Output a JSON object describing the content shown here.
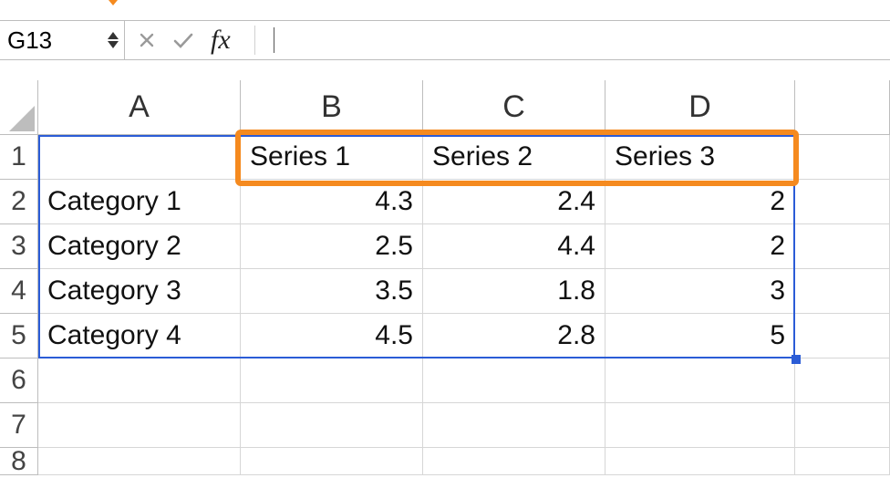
{
  "formula_bar": {
    "name_box": "G13",
    "fx_label": "fx",
    "input_value": ""
  },
  "columns": [
    "A",
    "B",
    "C",
    "D"
  ],
  "row_headers": [
    "1",
    "2",
    "3",
    "4",
    "5",
    "6",
    "7",
    "8"
  ],
  "cells": {
    "B1": "Series 1",
    "C1": "Series 2",
    "D1": "Series 3",
    "A2": "Category 1",
    "B2": "4.3",
    "C2": "2.4",
    "D2": "2",
    "A3": "Category 2",
    "B3": "2.5",
    "C3": "4.4",
    "D3": "2",
    "A4": "Category 3",
    "B4": "3.5",
    "C4": "1.8",
    "D4": "3",
    "A5": "Category 4",
    "B5": "4.5",
    "C5": "2.8",
    "D5": "5"
  },
  "chart_data": {
    "type": "table",
    "categories": [
      "Category 1",
      "Category 2",
      "Category 3",
      "Category 4"
    ],
    "series": [
      {
        "name": "Series 1",
        "values": [
          4.3,
          2.5,
          3.5,
          4.5
        ]
      },
      {
        "name": "Series 2",
        "values": [
          2.4,
          4.4,
          1.8,
          2.8
        ]
      },
      {
        "name": "Series 3",
        "values": [
          2,
          2,
          3,
          5
        ]
      }
    ]
  },
  "highlight": {
    "range": "B1:D1"
  },
  "selection": {
    "range": "A1:D5"
  }
}
